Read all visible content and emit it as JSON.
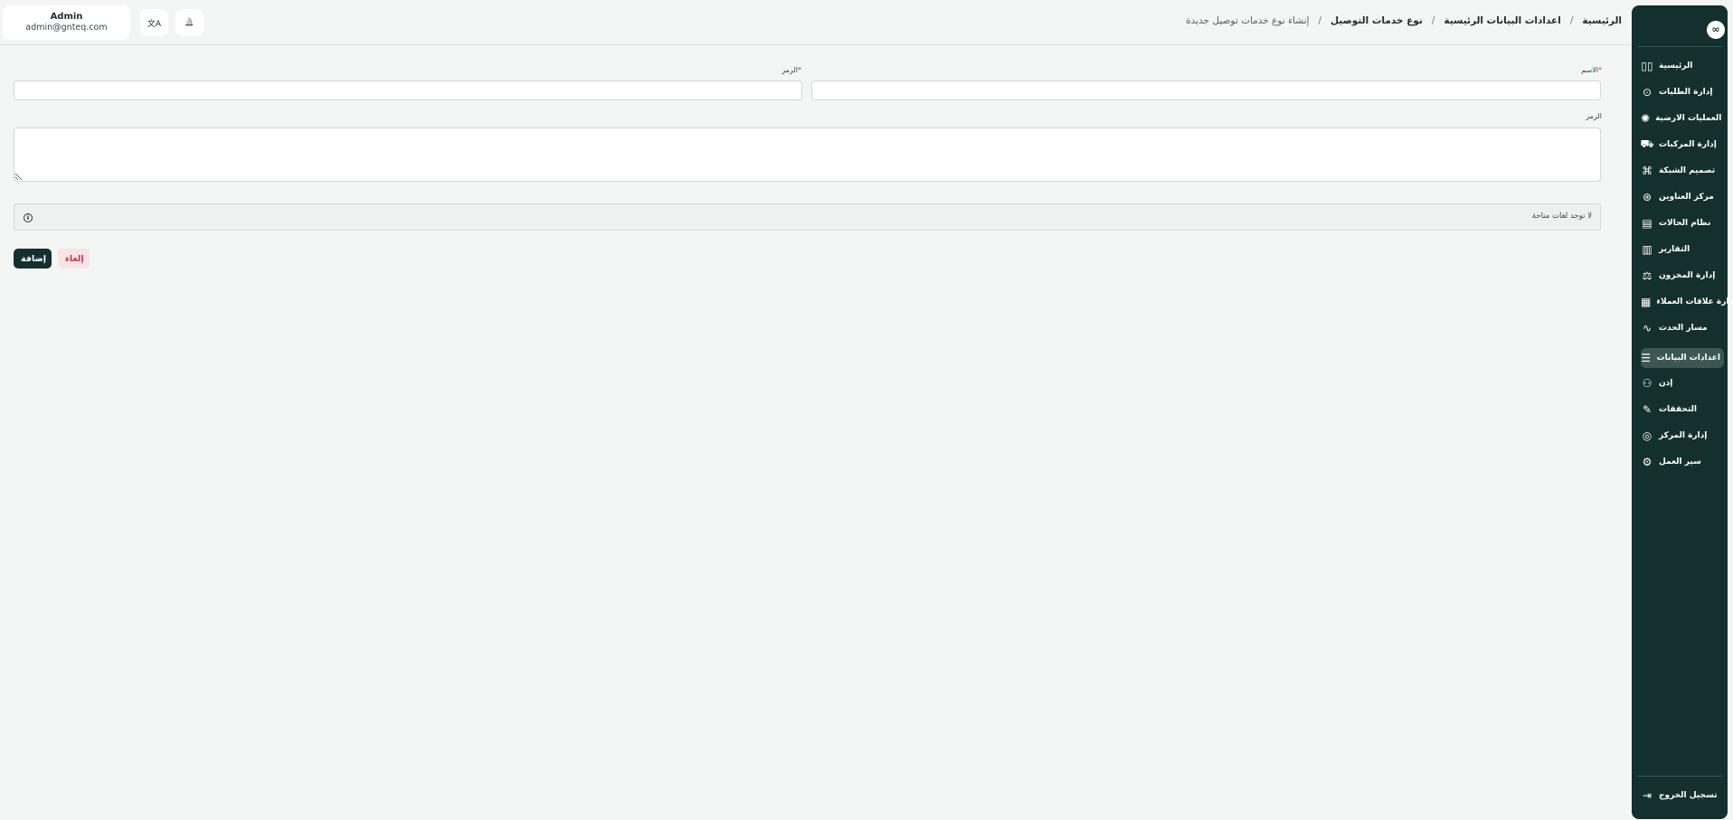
{
  "user": {
    "name": "Admin",
    "email": "admin@gnteq.com"
  },
  "topbar": {
    "translate_icon": "文A",
    "bell_icon": "🔔"
  },
  "breadcrumb": {
    "items": [
      "الرئيسية",
      "اعدادات البيانات الرئيسية",
      "نوع خدمات التوصيل"
    ],
    "current": "إنشاء نوع خدمات توصيل جديدة",
    "separator": "/"
  },
  "sidebar": {
    "logo": "∞",
    "items": [
      {
        "label": "الرئيسية",
        "icon": "▯▯"
      },
      {
        "label": "إدارة الطلبات",
        "icon": "⊙"
      },
      {
        "label": "العمليات الارضية",
        "icon": "✺"
      },
      {
        "label": "إدارة المركبات",
        "icon": "⛟"
      },
      {
        "label": "تصميم الشبكة",
        "icon": "⌘"
      },
      {
        "label": "مركز العناوين",
        "icon": "⊛"
      },
      {
        "label": "نظام الحالات",
        "icon": "▤"
      },
      {
        "label": "التقارير",
        "icon": "▥"
      },
      {
        "label": "إدارة المخزون",
        "icon": "⚖"
      },
      {
        "label": "إدارة علاقات العملاء",
        "icon": "▦"
      },
      {
        "label": "مسار الحدث",
        "icon": "∿"
      },
      {
        "label": "اعدادات البيانات",
        "icon": "☰"
      },
      {
        "label": "إذن",
        "icon": "⚇"
      },
      {
        "label": "التحققات",
        "icon": "✎"
      },
      {
        "label": "إدارة المركز",
        "icon": "◎"
      },
      {
        "label": "سير العمل",
        "icon": "⚙"
      }
    ],
    "active_index": 11,
    "logout": {
      "label": "تسجيل الخروج",
      "icon": "⇥"
    }
  },
  "form": {
    "name_label": "الاسم",
    "code_label": "الرمز",
    "description_label": "الرمز",
    "required_mark": "*",
    "name_value": "",
    "code_value": "",
    "description_value": ""
  },
  "notice": {
    "text": "لا توجد لغات متاحة",
    "icon": "i"
  },
  "actions": {
    "add_label": "إضافة",
    "cancel_label": "إلغاء"
  }
}
